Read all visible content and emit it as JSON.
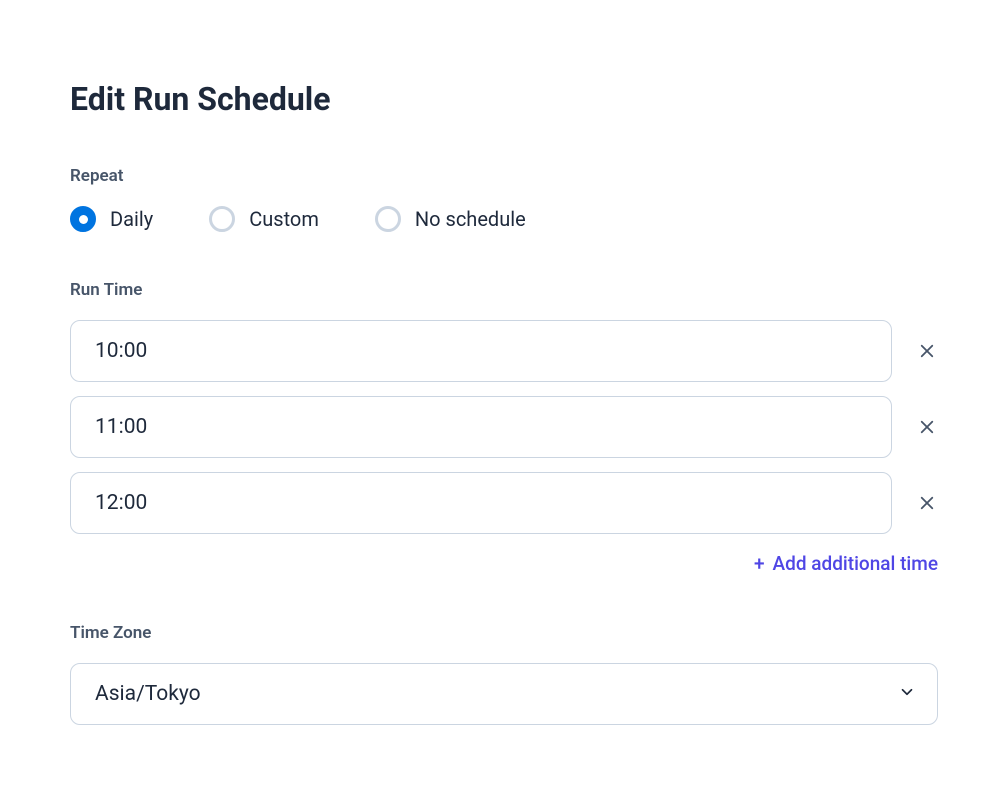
{
  "title": "Edit Run Schedule",
  "repeat": {
    "label": "Repeat",
    "options": [
      {
        "label": "Daily",
        "selected": true
      },
      {
        "label": "Custom",
        "selected": false
      },
      {
        "label": "No schedule",
        "selected": false
      }
    ]
  },
  "runTime": {
    "label": "Run Time",
    "times": [
      "10:00",
      "11:00",
      "12:00"
    ],
    "addLabel": "Add additional time"
  },
  "timezone": {
    "label": "Time Zone",
    "value": "Asia/Tokyo"
  }
}
